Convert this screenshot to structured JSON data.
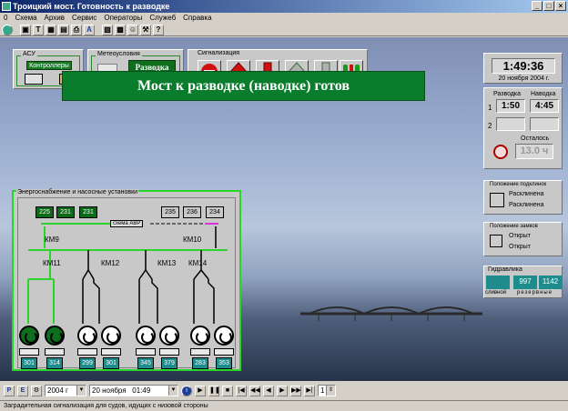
{
  "window": {
    "title": "Троицкий мост. Готовность к разводке",
    "controls": [
      "_",
      "□",
      "×"
    ]
  },
  "menu": [
    "0",
    "Схема",
    "Архив",
    "Сервис",
    "Операторы",
    "Служеб",
    "Справка"
  ],
  "toolbar": {
    "buttons": [
      "globe",
      "box",
      "T",
      "grid",
      "doc",
      "print",
      "A",
      "chart",
      "photo",
      "user",
      "tool",
      "?"
    ]
  },
  "acu": {
    "title": "АСУ",
    "controllers_label": "Контроллеры"
  },
  "meteo": {
    "title": "Метеоусловия",
    "status": "Разводка разрешена"
  },
  "signal": {
    "title": "Сигнализация"
  },
  "banner": "Мост к разводке (наводке) готов",
  "clock": {
    "time": "1:49:36",
    "date": "20 ноября 2004 г."
  },
  "schedule": {
    "col1": "Разводка",
    "col2": "Наводка",
    "rows": [
      {
        "n": "1",
        "raise": "1:50",
        "lower": "4:45"
      },
      {
        "n": "2",
        "raise": "",
        "lower": ""
      }
    ],
    "remaining_label": "Осталось",
    "remaining_value": "13.0 ч"
  },
  "supports": {
    "title": "Положение подклинок",
    "line1": "Расклинена",
    "line2": "Расклинена"
  },
  "locks": {
    "title": "Положение замков",
    "line1": "Открыт",
    "line2": "Открыт"
  },
  "hydraulics": {
    "title": "Гидравлика",
    "label": "сливной",
    "label2": "резервные",
    "v1": "997",
    "v2": "1142"
  },
  "power": {
    "title": "Энергоснабжение и насосные установки",
    "feeders_left": [
      "225",
      "231",
      "231"
    ],
    "feeders_right": [
      "235",
      "236",
      "234"
    ],
    "avr": "схема АВР",
    "km9": "КМ9",
    "km10": "КМ10",
    "km11": "КМ11",
    "km12": "КМ12",
    "km13": "КМ13",
    "km14": "КМ14",
    "pumps": [
      "301",
      "314",
      "299",
      "301",
      "345",
      "379",
      "283",
      "353"
    ]
  },
  "bottom": {
    "year": "2004 г",
    "date": "20 ноября",
    "time": "01:49",
    "page": "1"
  },
  "status": "Заградительная сигнализация для судов, идущих с низовой стороны"
}
